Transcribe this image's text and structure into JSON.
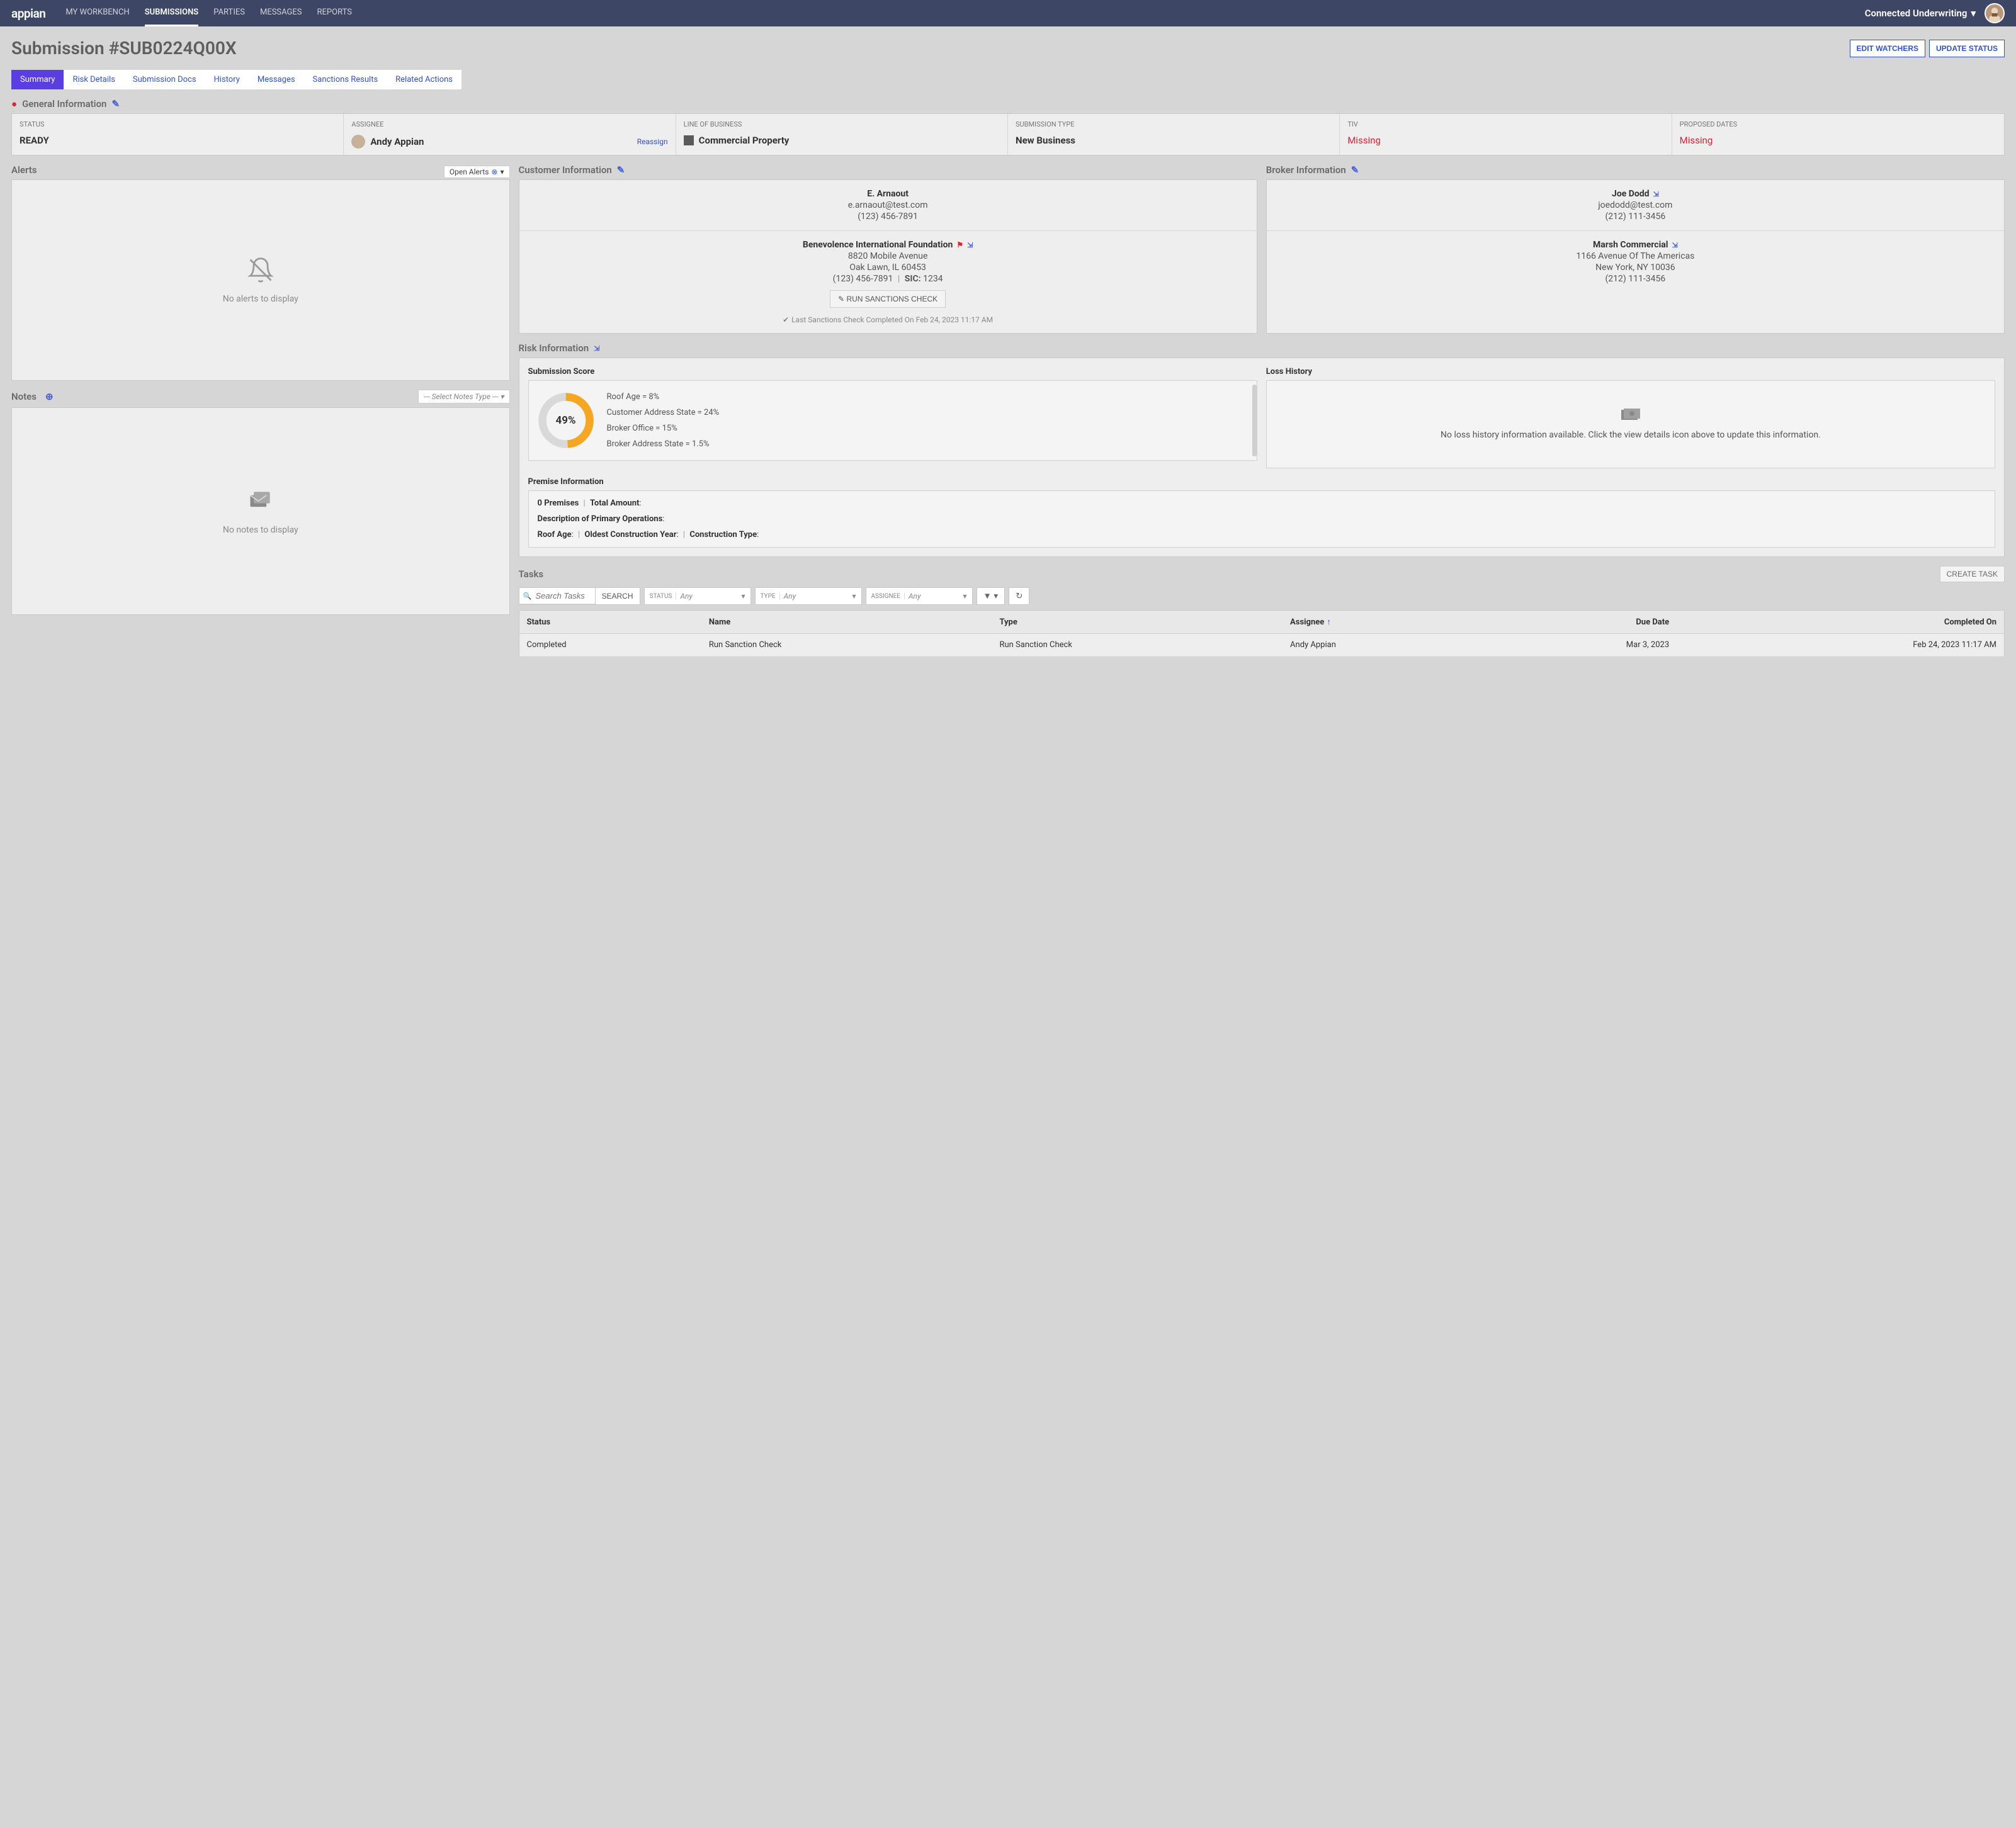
{
  "brand": "appian",
  "nav": {
    "items": [
      "MY WORKBENCH",
      "SUBMISSIONS",
      "PARTIES",
      "MESSAGES",
      "REPORTS"
    ],
    "active": 1,
    "env": "Connected Underwriting"
  },
  "page": {
    "title": "Submission #SUB0224Q00X",
    "actions": {
      "edit_watchers": "EDIT WATCHERS",
      "update_status": "UPDATE STATUS"
    }
  },
  "tabs": {
    "items": [
      "Summary",
      "Risk Details",
      "Submission Docs",
      "History",
      "Messages",
      "Sanctions Results",
      "Related Actions"
    ],
    "active": 0
  },
  "general": {
    "title": "General Information",
    "status": {
      "label": "STATUS",
      "value": "READY"
    },
    "assignee": {
      "label": "ASSIGNEE",
      "value": "Andy Appian",
      "reassign": "Reassign"
    },
    "lob": {
      "label": "LINE OF BUSINESS",
      "value": "Commercial Property"
    },
    "submission_type": {
      "label": "SUBMISSION TYPE",
      "value": "New Business"
    },
    "tiv": {
      "label": "TIV",
      "value": "Missing"
    },
    "proposed_dates": {
      "label": "PROPOSED DATES",
      "value": "Missing"
    }
  },
  "alerts": {
    "title": "Alerts",
    "filter": "Open Alerts",
    "empty": "No alerts to display"
  },
  "notes": {
    "title": "Notes",
    "select_placeholder": "--- Select Notes Type ---",
    "empty": "No notes to display"
  },
  "customer": {
    "title": "Customer Information",
    "contact": {
      "name": "E. Arnaout",
      "email": "e.arnaout@test.com",
      "phone": "(123) 456-7891"
    },
    "company": {
      "name": "Benevolence International Foundation",
      "address1": "8820 Mobile Avenue",
      "address2": "Oak Lawn, IL 60453",
      "phone": "(123) 456-7891",
      "sic_label": "SIC:",
      "sic": "1234",
      "sanctions_btn": "RUN SANCTIONS CHECK",
      "sanctions_note": "Last Sanctions Check Completed On Feb 24, 2023 11:17 AM"
    }
  },
  "broker": {
    "title": "Broker Information",
    "contact": {
      "name": "Joe Dodd",
      "email": "joedodd@test.com",
      "phone": "(212) 111-3456"
    },
    "company": {
      "name": "Marsh Commercial",
      "address1": "1166 Avenue Of The Americas",
      "address2": "New York, NY 10036",
      "phone": "(212) 111-3456"
    }
  },
  "risk": {
    "title": "Risk Information",
    "score_title": "Submission Score",
    "score_pct": "49%",
    "factors": [
      "Roof Age = 8%",
      "Customer Address State = 24%",
      "Broker Office = 15%",
      "Broker Address State = 1.5%"
    ],
    "loss_title": "Loss History",
    "loss_empty": "No loss history information available. Click the view details icon above to update this information.",
    "premise_title": "Premise Information",
    "premise": {
      "premises_label": "0 Premises",
      "total_amount_label": "Total Amount",
      "desc_label": "Description of Primary Operations",
      "roof_age_label": "Roof Age",
      "oldest_year_label": "Oldest Construction Year",
      "construction_type_label": "Construction Type"
    }
  },
  "chart_data": {
    "type": "pie",
    "title": "Submission Score",
    "values": [
      49,
      51
    ],
    "categories": [
      "Score",
      "Remaining"
    ],
    "colors": [
      "#f5a623",
      "#d9d9d9"
    ],
    "center_label": "49%"
  },
  "tasks": {
    "title": "Tasks",
    "create_btn": "CREATE TASK",
    "search_placeholder": "Search Tasks",
    "search_btn": "SEARCH",
    "filters": {
      "status": {
        "label": "STATUS",
        "value": "Any"
      },
      "type": {
        "label": "TYPE",
        "value": "Any"
      },
      "assignee": {
        "label": "ASSIGNEE",
        "value": "Any"
      }
    },
    "columns": [
      "Status",
      "Name",
      "Type",
      "Assignee",
      "Due Date",
      "Completed On"
    ],
    "rows": [
      {
        "status": "Completed",
        "name": "Run Sanction Check",
        "type": "Run Sanction Check",
        "assignee": "Andy Appian",
        "due": "Mar 3, 2023",
        "completed": "Feb 24, 2023 11:17 AM"
      }
    ]
  }
}
